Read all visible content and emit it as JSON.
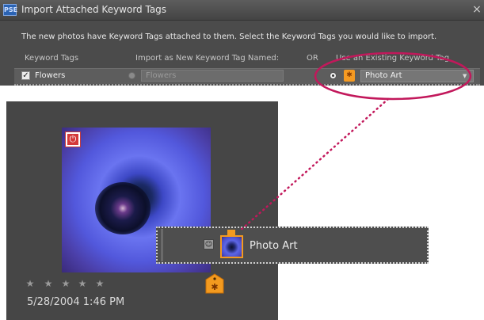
{
  "dialog": {
    "app_icon": "PSE",
    "title": "Import Attached Keyword Tags",
    "close_symbol": "×",
    "instructions": "The new photos have Keyword Tags attached to them.  Select the Keyword Tags you would like to import.",
    "columns": {
      "keyword_tags": "Keyword Tags",
      "import_as": "Import as New Keyword Tag Named:",
      "or": "OR",
      "existing": "Use an Existing Keyword Tag"
    },
    "row": {
      "checked_mark": "✓",
      "keyword": "Flowers",
      "new_name_value": "Flowers",
      "existing_value": "Photo Art",
      "select_arrow": "▼",
      "tag_icon": "tag-icon"
    }
  },
  "photo_card": {
    "badge_icon": "power-icon",
    "badge_symbol": "⏻",
    "rating_stars": 0,
    "star_glyph": "★",
    "date": "5/28/2004 1:46 PM",
    "tag_icon": "keyword-tag-icon"
  },
  "tag_popup": {
    "face_icon": "face-tag-icon",
    "face_symbol": "☺",
    "label": "Photo Art"
  },
  "colors": {
    "accent_orange": "#f39a1f",
    "callout_magenta": "#c2185b",
    "dialog_bg": "#4b4b4b",
    "panel_bg": "#464646"
  }
}
